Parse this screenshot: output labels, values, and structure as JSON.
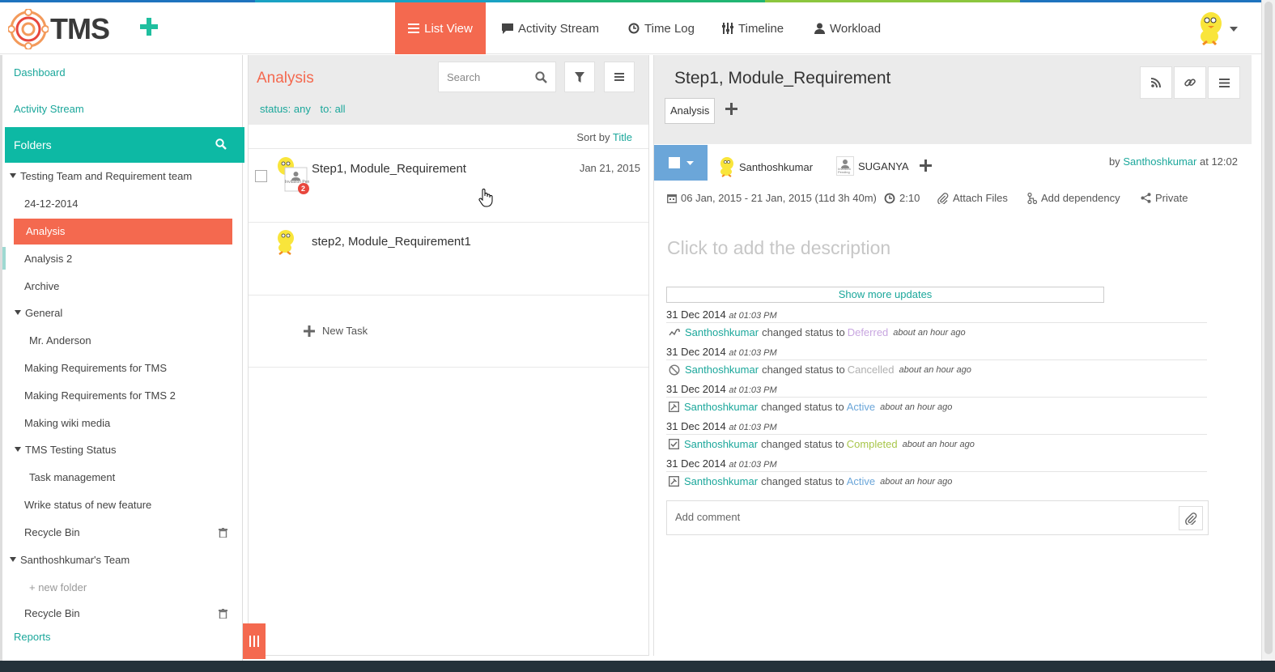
{
  "app": {
    "logo_text": "TMS",
    "stripe_colors": [
      "#1e73be",
      "#1aa2c4",
      "#21b573",
      "#8cc63e",
      "#1e73be"
    ]
  },
  "colors": {
    "accent": "#f4694f",
    "teal": "#0db9a4",
    "link": "#1ba79b",
    "status_blue": "#6ba6d9"
  },
  "nav": {
    "list_view": "List View",
    "activity_stream": "Activity Stream",
    "time_log": "Time Log",
    "timeline": "Timeline",
    "workload": "Workload"
  },
  "sidebar": {
    "dashboard": "Dashboard",
    "activity_stream": "Activity Stream",
    "folders": "Folders",
    "tree": [
      "Testing Team and Requirement team",
      "24-12-2014",
      "Analysis",
      "Analysis 2",
      "Archive",
      "General",
      "Mr. Anderson",
      "Making Requirements for TMS",
      "Making Requirements for TMS 2",
      "Making wiki media",
      "TMS Testing Status",
      "Task management",
      "Wrike status of new feature",
      "Recycle Bin",
      "Santhoshkumar's Team",
      "+ new folder",
      "Recycle Bin"
    ],
    "reports": "Reports"
  },
  "middle": {
    "title": "Analysis",
    "search_placeholder": "Search",
    "filter_status": "status: any",
    "filter_to": "to: all",
    "sort_prefix": "Sort by",
    "sort_field": "Title",
    "tasks": [
      {
        "title": "Step1, Module_Requirement",
        "date": "Jan 21, 2015",
        "badge": "2",
        "avatar_caption": "Invitation Pen"
      },
      {
        "title": "step2, Module_Requirement1",
        "date": ""
      }
    ],
    "new_task": "New Task"
  },
  "detail": {
    "title": "Step1, Module_Requirement",
    "folder_tag": "Analysis",
    "assignees": [
      "Santhoshkumar",
      "SUGANYA"
    ],
    "assignee_caption": "Invitation Pending",
    "by_prefix": "by",
    "by_user": "Santhoshkumar",
    "by_time": "at 12:02",
    "dates": "06 Jan, 2015 - 21 Jan, 2015 (11d 3h 40m)",
    "time_spent": "2:10",
    "attach_files": "Attach Files",
    "add_dependency": "Add dependency",
    "private": "Private",
    "description_placeholder": "Click to add the description",
    "show_more": "Show more updates",
    "updates": [
      {
        "date": "31 Dec 2014",
        "time": "at 01:03 PM",
        "icon": "deferred-icon",
        "user": "Santhoshkumar",
        "action": "changed status to",
        "status": "Deferred",
        "status_color": "#c8a6e0",
        "ago": "about an hour ago"
      },
      {
        "date": "31 Dec 2014",
        "time": "at 01:03 PM",
        "icon": "cancelled-icon",
        "user": "Santhoshkumar",
        "action": "changed status to",
        "status": "Cancelled",
        "status_color": "#b0b0b0",
        "ago": "about an hour ago"
      },
      {
        "date": "31 Dec 2014",
        "time": "at 01:03 PM",
        "icon": "active-icon",
        "user": "Santhoshkumar",
        "action": "changed status to",
        "status": "Active",
        "status_color": "#6ba6d9",
        "ago": "about an hour ago"
      },
      {
        "date": "31 Dec 2014",
        "time": "at 01:03 PM",
        "icon": "completed-icon",
        "user": "Santhoshkumar",
        "action": "changed status to",
        "status": "Completed",
        "status_color": "#a8c64a",
        "ago": "about an hour ago"
      },
      {
        "date": "31 Dec 2014",
        "time": "at 01:03 PM",
        "icon": "active-icon",
        "user": "Santhoshkumar",
        "action": "changed status to",
        "status": "Active",
        "status_color": "#6ba6d9",
        "ago": "about an hour ago"
      }
    ],
    "comment_placeholder": "Add comment"
  }
}
